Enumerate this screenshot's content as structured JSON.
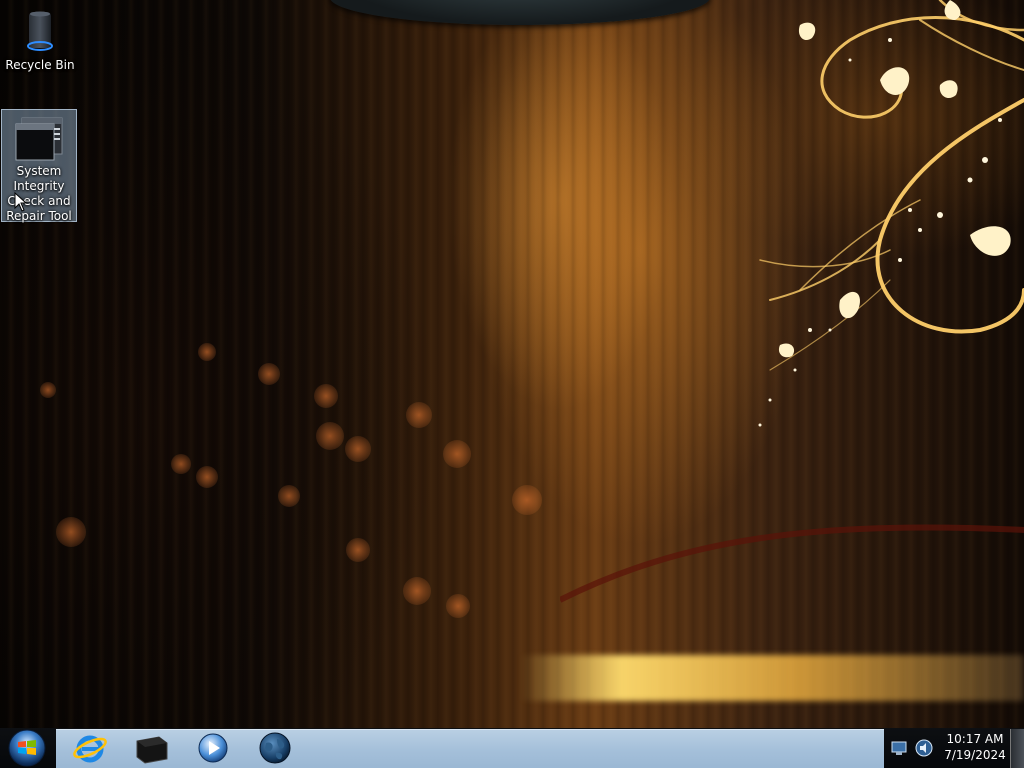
{
  "desktop": {
    "icons": [
      {
        "label": "Recycle Bin",
        "icon": "recycle-bin-icon"
      },
      {
        "label": "System Integrity Check and Repair Tool",
        "icon": "console-window-icon"
      }
    ]
  },
  "taskbar": {
    "start_icon": "windows-start-orb-icon",
    "pinned": [
      {
        "name": "Internet Explorer",
        "icon": "internet-explorer-icon"
      },
      {
        "name": "Terminal",
        "icon": "terminal-icon"
      },
      {
        "name": "Media Player",
        "icon": "media-player-icon"
      },
      {
        "name": "Network Globe",
        "icon": "globe-icon"
      }
    ],
    "tray_icons": [
      "network-icon",
      "volume-icon"
    ],
    "clock": {
      "time": "10:17 AM",
      "date": "7/19/2024"
    }
  },
  "colors": {
    "taskbar_band": "#a5c0da",
    "selection": "#a0bedc",
    "accent_gold": "#ffcc66"
  }
}
